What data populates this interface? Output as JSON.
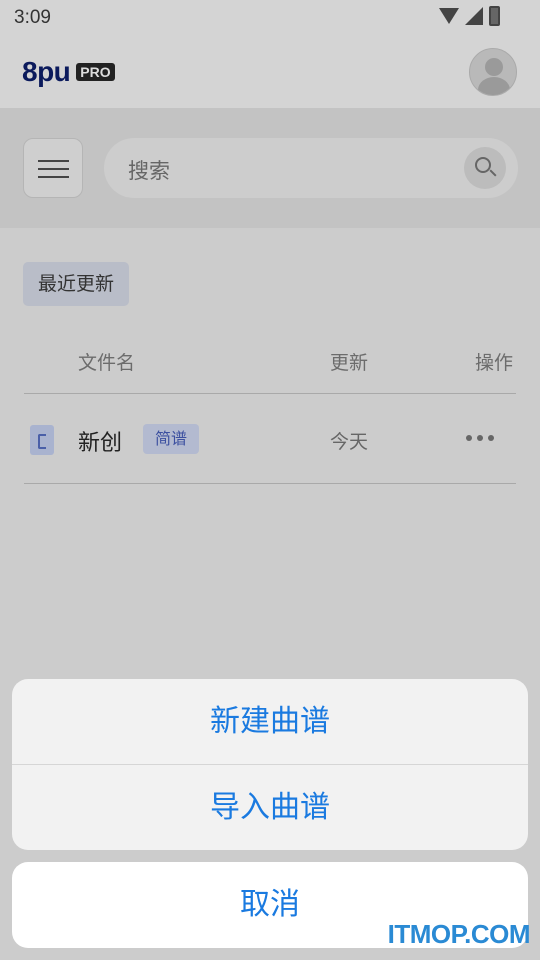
{
  "status_bar": {
    "time": "3:09"
  },
  "app": {
    "logo_text": "8pu",
    "logo_badge": "PRO"
  },
  "search": {
    "placeholder": "搜索"
  },
  "filter": {
    "recent_tag": "最近更新"
  },
  "table": {
    "headers": {
      "name": "文件名",
      "updated": "更新",
      "actions": "操作"
    },
    "rows": [
      {
        "name": "新创",
        "badge": "简谱",
        "updated": "今天"
      }
    ]
  },
  "action_sheet": {
    "options": [
      "新建曲谱",
      "导入曲谱"
    ],
    "cancel": "取消"
  },
  "watermark": "ITMOP.COM",
  "colors": {
    "accent": "#1a7ae0",
    "logo": "#0b1a5c",
    "badge_text": "#3c50a0"
  }
}
